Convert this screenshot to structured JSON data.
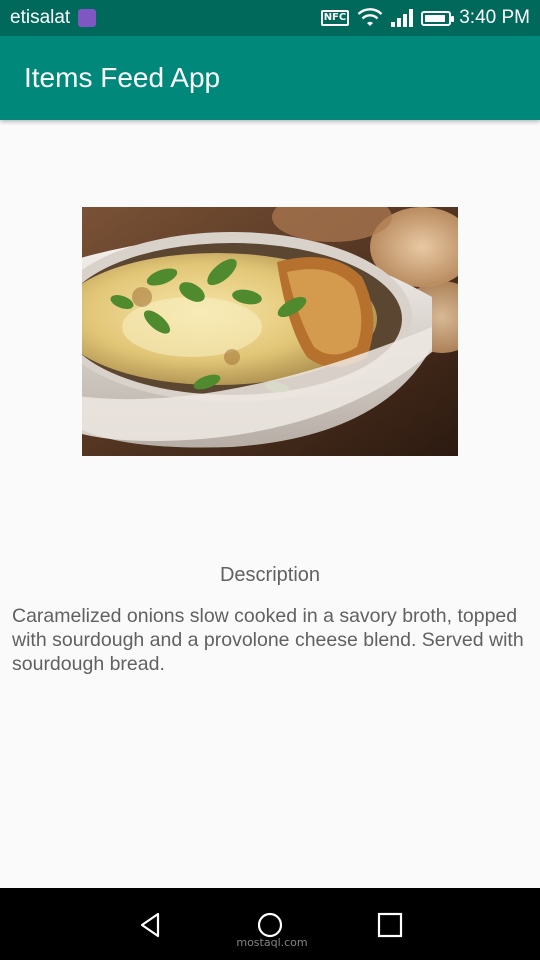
{
  "status_bar": {
    "carrier": "etisalat",
    "nfc_label": "NFC",
    "time": "3:40 PM",
    "icons": [
      "app-notification-icon",
      "nfc-icon",
      "wifi-icon",
      "signal-icon",
      "battery-icon"
    ],
    "battery_level": 0.9
  },
  "app_bar": {
    "title": "Items Feed App",
    "color": "#00897b",
    "status_color": "#00695c"
  },
  "item": {
    "image_icon": "french-onion-soup-image",
    "description_label": "Description",
    "description": "Caramelized onions slow cooked in a savory broth, topped with sourdough and a provolone cheese blend. Served with sourdough bread."
  },
  "nav_bar": {
    "buttons": [
      "back-icon",
      "home-icon",
      "recents-icon"
    ],
    "watermark": "mostaql.com"
  }
}
